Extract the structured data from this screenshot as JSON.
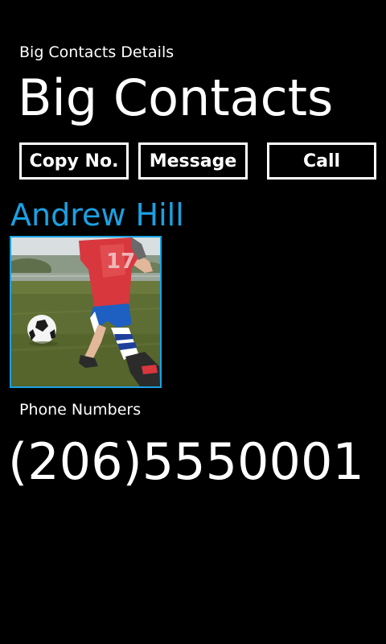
{
  "header": {
    "app_subtitle": "Big Contacts Details",
    "page_title": "Big Contacts"
  },
  "actions": {
    "copy_label": "Copy No.",
    "message_label": "Message",
    "call_label": "Call"
  },
  "contact": {
    "name": "Andrew Hill",
    "photo_icon": "contact-photo"
  },
  "phone": {
    "section_label": "Phone Numbers",
    "number": "(206)5550001"
  },
  "colors": {
    "background": "#000000",
    "foreground": "#ffffff",
    "accent": "#1ba1e2"
  }
}
